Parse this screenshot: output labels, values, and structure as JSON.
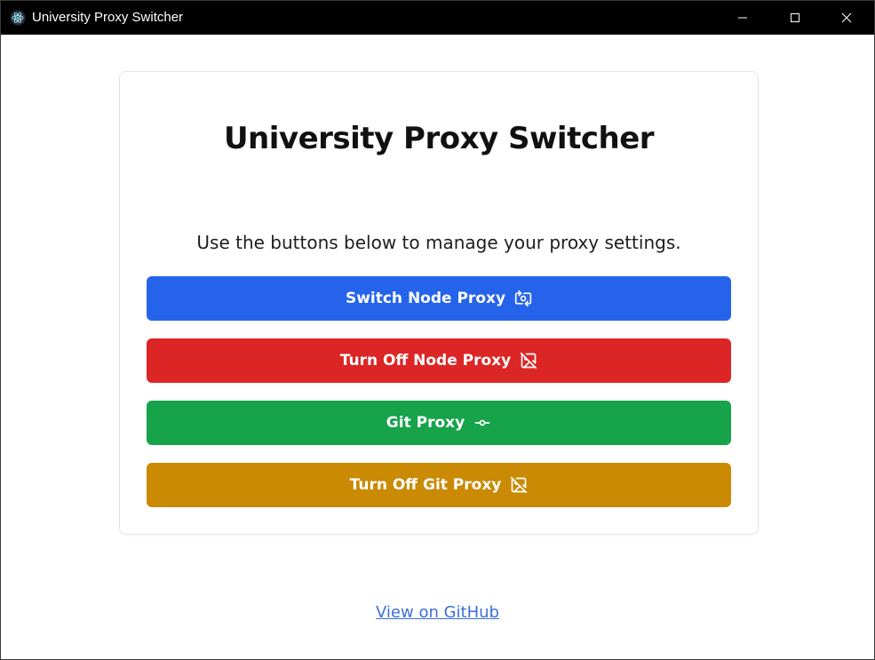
{
  "window": {
    "title": "University Proxy Switcher",
    "icon": "electron-atom-icon"
  },
  "controls": {
    "minimize_icon": "minimize-icon",
    "maximize_icon": "maximize-icon",
    "close_icon": "close-icon"
  },
  "main": {
    "heading": "University Proxy Switcher",
    "subtitle": "Use the buttons below to manage your proxy settings.",
    "buttons": [
      {
        "label": "Switch Node Proxy",
        "icon": "switch-camera-icon",
        "color": "#2563eb"
      },
      {
        "label": "Turn Off Node Proxy",
        "icon": "image-off-icon",
        "color": "#dc2626"
      },
      {
        "label": "Git Proxy",
        "icon": "git-commit-icon",
        "color": "#16a34a"
      },
      {
        "label": "Turn Off Git Proxy",
        "icon": "image-off-icon",
        "color": "#ca8a04"
      }
    ]
  },
  "footer": {
    "link_label": "View on GitHub",
    "link_color": "#3b6fd8"
  }
}
